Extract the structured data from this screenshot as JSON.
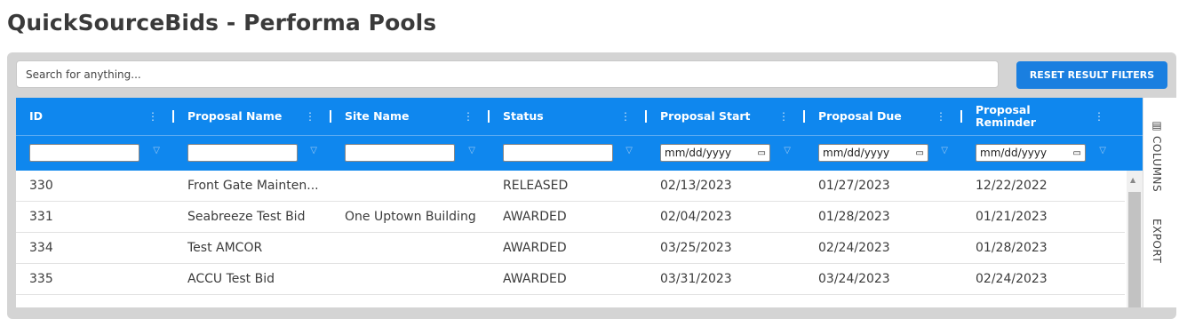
{
  "page": {
    "title": "QuickSourceBids - Performa Pools"
  },
  "search": {
    "placeholder": "Search for anything..."
  },
  "toolbar": {
    "reset_label": "RESET RESULT FILTERS"
  },
  "grid": {
    "columns": [
      {
        "key": "id",
        "label": "ID"
      },
      {
        "key": "proposal_name",
        "label": "Proposal Name"
      },
      {
        "key": "site_name",
        "label": "Site Name"
      },
      {
        "key": "status",
        "label": "Status"
      },
      {
        "key": "proposal_start",
        "label": "Proposal Start"
      },
      {
        "key": "proposal_due",
        "label": "Proposal Due"
      },
      {
        "key": "proposal_reminder",
        "label": "Proposal Reminder"
      }
    ],
    "date_placeholder": "mm/dd/yyyy",
    "rows": [
      [
        "330",
        "Front Gate Mainten...",
        "",
        "RELEASED",
        "02/13/2023",
        "01/27/2023",
        "12/22/2022"
      ],
      [
        "331",
        "Seabreeze Test Bid",
        "One Uptown Building",
        "AWARDED",
        "02/04/2023",
        "01/28/2023",
        "01/21/2023"
      ],
      [
        "334",
        "Test AMCOR",
        "",
        "AWARDED",
        "03/25/2023",
        "02/24/2023",
        "01/28/2023"
      ],
      [
        "335",
        "ACCU Test Bid",
        "",
        "AWARDED",
        "03/31/2023",
        "03/24/2023",
        "02/24/2023"
      ]
    ]
  },
  "side_panel": {
    "columns_label": "COLUMNS",
    "export_label": "EXPORT"
  },
  "icons": {
    "column_menu": "vertical-ellipsis-icon",
    "filter": "funnel-icon",
    "calendar": "calendar-icon",
    "columns": "columns-icon"
  },
  "colors": {
    "header_bg": "#0f87ee",
    "button_bg": "#1a7fe0"
  }
}
